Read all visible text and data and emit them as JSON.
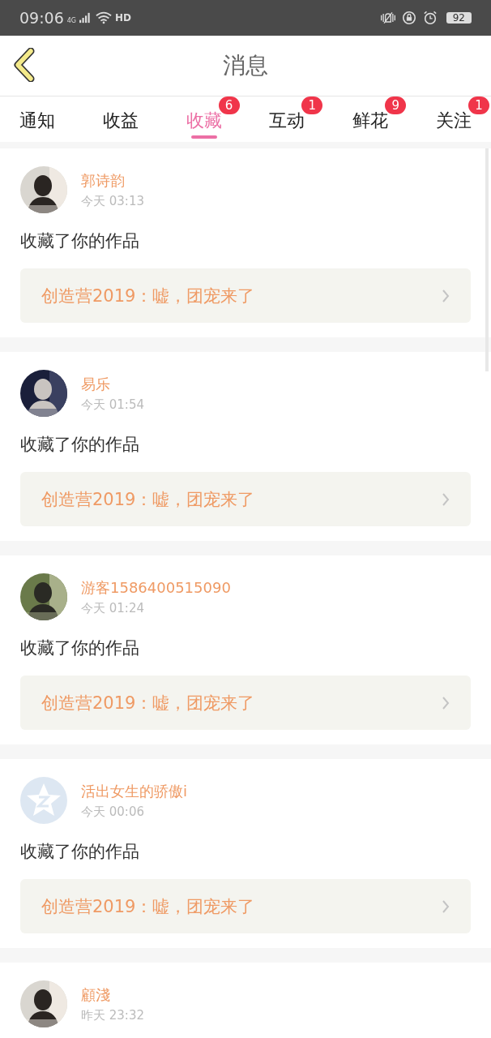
{
  "status_bar": {
    "time": "09:06",
    "network": "4G",
    "wifi_tag": "HD",
    "battery": "92"
  },
  "header": {
    "title": "消息"
  },
  "tabs": [
    {
      "label": "通知",
      "selected": false
    },
    {
      "label": "收益",
      "selected": false
    },
    {
      "label": "收藏",
      "selected": true,
      "badge": "6"
    },
    {
      "label": "互动",
      "selected": false,
      "badge": "1"
    },
    {
      "label": "鲜花",
      "selected": false,
      "badge": "9"
    },
    {
      "label": "关注",
      "selected": false,
      "badge": "1"
    }
  ],
  "messages": [
    {
      "user": "郭诗韵",
      "time": "今天 03:13",
      "text": "收藏了你的作品",
      "work": "创造营2019：嘘，团宠来了"
    },
    {
      "user": "易乐",
      "time": "今天 01:54",
      "text": "收藏了你的作品",
      "work": "创造营2019：嘘，团宠来了"
    },
    {
      "user": "游客1586400515090",
      "time": "今天 01:24",
      "text": "收藏了你的作品",
      "work": "创造营2019：嘘，团宠来了"
    },
    {
      "user": "活出女生的骄傲i",
      "time": "今天 00:06",
      "avatar": {
        "kind": "default"
      },
      "text": "收藏了你的作品",
      "work": "创造营2019：嘘，团宠来了"
    },
    {
      "user": "顧淺",
      "time": "昨天 23:32"
    }
  ]
}
